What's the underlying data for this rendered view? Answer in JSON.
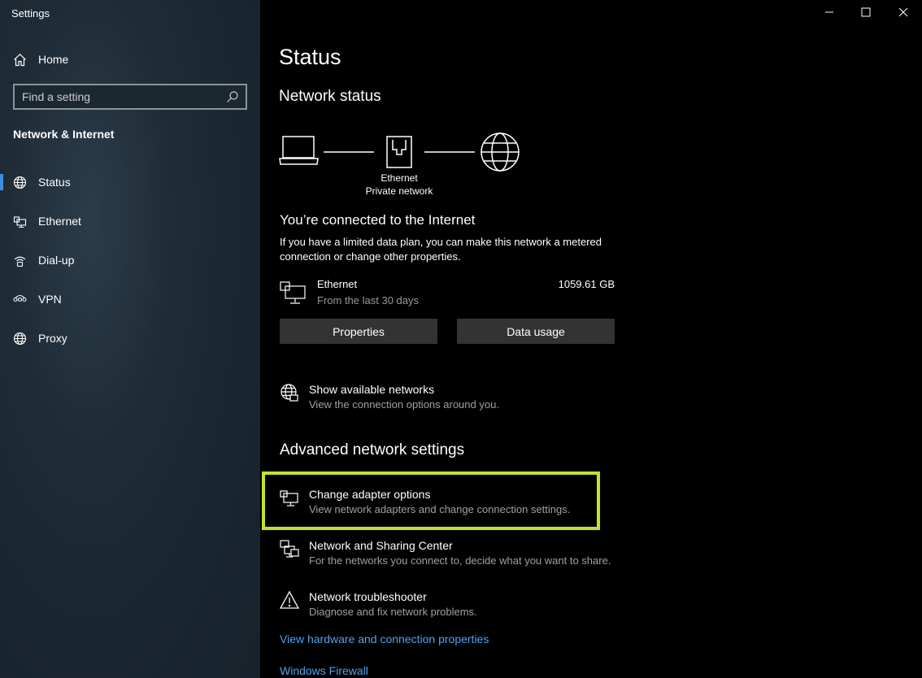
{
  "window": {
    "title": "Settings"
  },
  "sidebar": {
    "home_label": "Home",
    "search": {
      "placeholder": "Find a setting"
    },
    "section": "Network & Internet",
    "items": [
      {
        "label": "Status",
        "icon": "globe-status-icon",
        "active": true
      },
      {
        "label": "Ethernet",
        "icon": "ethernet-icon",
        "active": false
      },
      {
        "label": "Dial-up",
        "icon": "dialup-icon",
        "active": false
      },
      {
        "label": "VPN",
        "icon": "vpn-icon",
        "active": false
      },
      {
        "label": "Proxy",
        "icon": "globe-icon",
        "active": false
      }
    ]
  },
  "main": {
    "title": "Status",
    "network_status": "Network status",
    "diagram": {
      "line1": "Ethernet",
      "line2": "Private network"
    },
    "connected_heading": "You’re connected to the Internet",
    "description": "If you have a limited data plan, you can make this network a metered connection or change other properties.",
    "ethernet": {
      "name": "Ethernet",
      "period": "From the last 30 days",
      "usage": "1059.61 GB"
    },
    "buttons": {
      "properties": "Properties",
      "data_usage": "Data usage"
    },
    "show_networks": {
      "title": "Show available networks",
      "subtitle": "View the connection options around you."
    },
    "advanced_heading": "Advanced network settings",
    "advanced": [
      {
        "title": "Change adapter options",
        "subtitle": "View network adapters and change connection settings."
      },
      {
        "title": "Network and Sharing Center",
        "subtitle": "For the networks you connect to, decide what you want to share."
      },
      {
        "title": "Network troubleshooter",
        "subtitle": "Diagnose and fix network problems."
      }
    ],
    "links": {
      "hardware": "View hardware and connection properties",
      "firewall": "Windows Firewall"
    }
  },
  "colors": {
    "accent": "#3d8ee0",
    "highlight": "#c2e22c",
    "link": "#4ea3f0",
    "button": "#333333"
  }
}
